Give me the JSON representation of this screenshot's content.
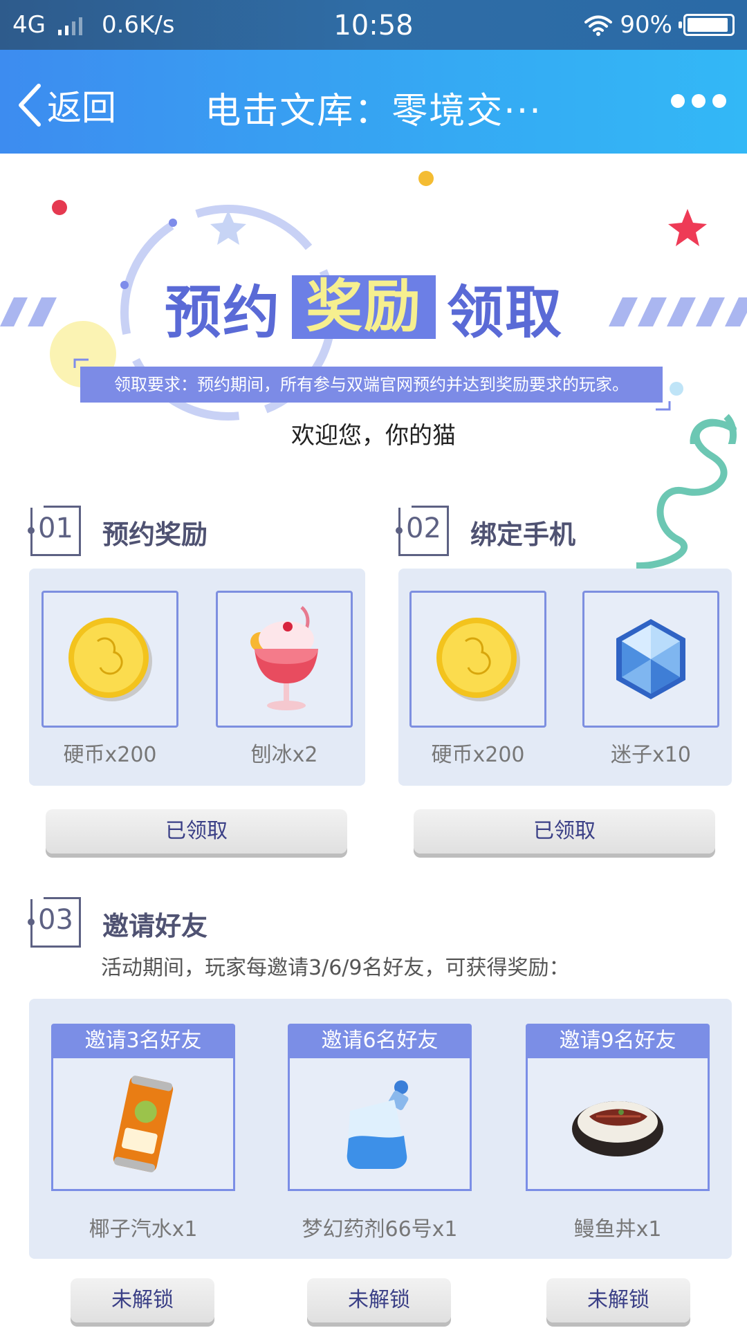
{
  "status_bar": {
    "network": "4G",
    "speed": "0.6K/s",
    "time": "10:58",
    "battery": "90%"
  },
  "nav": {
    "back_label": "返回",
    "title": "电击文库：零境交···"
  },
  "banner": {
    "title_part1": "预约",
    "title_highlight": "奖励",
    "title_part2": "领取",
    "requirement": "领取要求：预约期间，所有参与双端官网预约并达到奖励要求的玩家。"
  },
  "welcome": "欢迎您，你的猫",
  "section1": {
    "number": "01",
    "title": "预约奖励",
    "items": [
      {
        "name": "硬币x200",
        "icon": "gold-coin-icon"
      },
      {
        "name": "刨冰x2",
        "icon": "shaved-ice-icon"
      }
    ],
    "button": "已领取"
  },
  "section2": {
    "number": "02",
    "title": "绑定手机",
    "items": [
      {
        "name": "硬币x200",
        "icon": "gold-coin-icon"
      },
      {
        "name": "迷子x10",
        "icon": "crystal-icon"
      }
    ],
    "button": "已领取"
  },
  "section3": {
    "number": "03",
    "title": "邀请好友",
    "description": "活动期间，玩家每邀请3/6/9名好友，可获得奖励：",
    "cards": [
      {
        "header": "邀请3名好友",
        "name": "椰子汽水x1",
        "icon": "soda-can-icon",
        "button": "未解锁"
      },
      {
        "header": "邀请6名好友",
        "name": "梦幻药剂66号x1",
        "icon": "potion-bottle-icon",
        "button": "未解锁"
      },
      {
        "header": "邀请9名好友",
        "name": "鳗鱼丼x1",
        "icon": "eel-rice-bowl-icon",
        "button": "未解锁"
      }
    ]
  },
  "colors": {
    "nav_blue": "#3d8cf0",
    "accent_purple": "#7b8ee6",
    "panel_bg": "#e3eaf6",
    "button_text": "#3a3f86"
  }
}
